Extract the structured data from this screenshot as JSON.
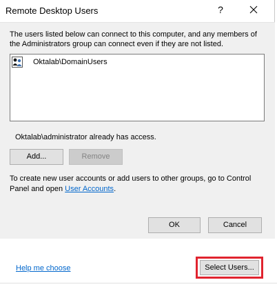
{
  "dialog": {
    "title": "Remote Desktop Users",
    "help_glyph": "?",
    "description": "The users listed below can connect to this computer, and any members of the Administrators group can connect even if they are not listed.",
    "users": [
      {
        "name": "Oktalab\\DomainUsers",
        "icon": "user-group-icon"
      }
    ],
    "access_text": "Oktalab\\administrator already has access.",
    "add_label": "Add...",
    "remove_label": "Remove",
    "info_prefix": "To create new user accounts or add users to other groups, go to Control Panel and open ",
    "info_link": "User Accounts",
    "info_suffix": ".",
    "ok_label": "OK",
    "cancel_label": "Cancel"
  },
  "background": {
    "help_link": "Help me choose",
    "select_users_label": "Select Users..."
  },
  "colors": {
    "link": "#0066cc",
    "highlight": "#e0232e",
    "panel": "#f0f0f0"
  }
}
